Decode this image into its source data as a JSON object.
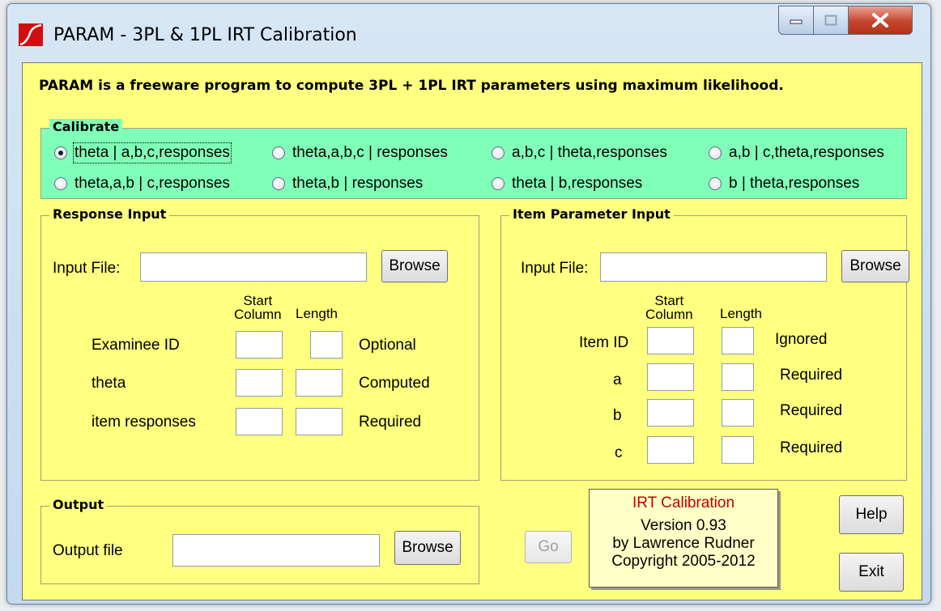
{
  "window": {
    "title": "PARAM - 3PL & 1PL IRT Calibration"
  },
  "intro": "PARAM is a freeware program to compute 3PL + 1PL IRT parameters using maximum likelihood.",
  "calibrate": {
    "label": "Calibrate",
    "selected": "theta | a,b,c,responses",
    "options": [
      "theta | a,b,c,responses",
      "theta,a,b,c | responses",
      "a,b,c | theta,responses",
      "a,b | c,theta,responses",
      "theta,a,b | c,responses",
      "theta,b | responses",
      "theta | b,responses",
      "b | theta,responses"
    ]
  },
  "response_input": {
    "label": "Response Input",
    "input_file_label": "Input File:",
    "input_file_value": "",
    "browse_label": "Browse",
    "col_start_line1": "Start",
    "col_start_line2": "Column",
    "col_length": "Length",
    "rows": [
      {
        "name": "Examinee ID",
        "status": "Optional"
      },
      {
        "name": "theta",
        "status": "Computed"
      },
      {
        "name": "item responses",
        "status": "Required"
      }
    ]
  },
  "item_param_input": {
    "label": "Item Parameter Input",
    "input_file_label": "Input File:",
    "input_file_value": "",
    "browse_label": "Browse",
    "col_start_line1": "Start",
    "col_start_line2": "Column",
    "col_length": "Length",
    "rows": [
      {
        "name": "Item ID",
        "status": "Ignored"
      },
      {
        "name": "a",
        "status": "Required"
      },
      {
        "name": "b",
        "status": "Required"
      },
      {
        "name": "c",
        "status": "Required"
      }
    ]
  },
  "output": {
    "label": "Output",
    "file_label": "Output file",
    "file_value": "",
    "browse_label": "Browse"
  },
  "actions": {
    "go_label": "Go",
    "help_label": "Help",
    "exit_label": "Exit"
  },
  "about": {
    "title": "IRT Calibration",
    "version": "Version 0.93",
    "author": "by Lawrence Rudner",
    "copyright": "Copyright 2005-2012"
  },
  "colors": {
    "client_bg": "#ffff80",
    "calibrate_bg": "#80ffb8",
    "about_title": "#c00000"
  }
}
